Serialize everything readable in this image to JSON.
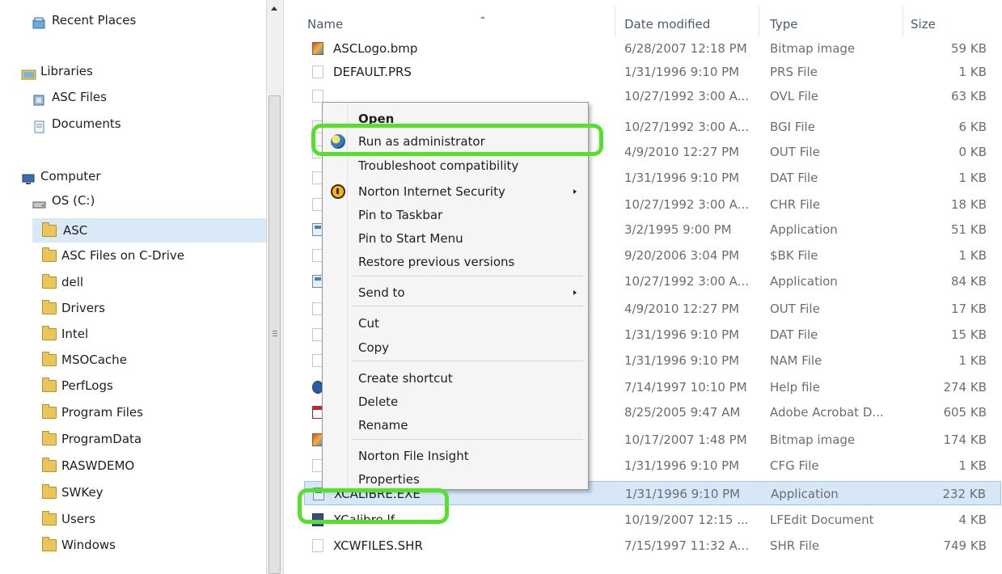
{
  "navigation": {
    "items": [
      {
        "label": "Recent Places",
        "icon": "recent-places-icon"
      },
      {
        "label": "Libraries",
        "icon": "libraries-icon"
      },
      {
        "label": "ASC Files",
        "icon": "library-icon"
      },
      {
        "label": "Documents",
        "icon": "documents-icon"
      },
      {
        "label": "Computer",
        "icon": "computer-icon"
      },
      {
        "label": "OS (C:)",
        "icon": "drive-icon"
      },
      {
        "label": "ASC",
        "icon": "folder-icon",
        "selected": true
      },
      {
        "label": "ASC Files on C-Drive",
        "icon": "folder-icon"
      },
      {
        "label": "dell",
        "icon": "folder-icon"
      },
      {
        "label": "Drivers",
        "icon": "folder-icon"
      },
      {
        "label": "Intel",
        "icon": "folder-icon"
      },
      {
        "label": "MSOCache",
        "icon": "folder-icon"
      },
      {
        "label": "PerfLogs",
        "icon": "folder-icon"
      },
      {
        "label": "Program Files",
        "icon": "folder-icon"
      },
      {
        "label": "ProgramData",
        "icon": "folder-icon"
      },
      {
        "label": "RASWDEMO",
        "icon": "folder-icon"
      },
      {
        "label": "SWKey",
        "icon": "folder-icon"
      },
      {
        "label": "Users",
        "icon": "folder-icon"
      },
      {
        "label": "Windows",
        "icon": "folder-icon"
      }
    ]
  },
  "file_list": {
    "columns": {
      "name": "Name",
      "date": "Date modified",
      "type": "Type",
      "size": "Size"
    },
    "rows": [
      {
        "name": "ASCLogo.bmp",
        "date": "6/28/2007 12:18 PM",
        "type": "Bitmap image",
        "size": "59 KB",
        "icon": "bmp"
      },
      {
        "name": "DEFAULT.PRS",
        "date": "1/31/1996 9:10 PM",
        "type": "PRS File",
        "size": "1 KB",
        "icon": "file"
      },
      {
        "name": "",
        "date": "10/27/1992 3:00 A...",
        "type": "OVL File",
        "size": "63 KB",
        "icon": "file"
      },
      {
        "name": "",
        "date": "10/27/1992 3:00 A...",
        "type": "BGI File",
        "size": "6 KB",
        "icon": "file"
      },
      {
        "name": "",
        "date": "4/9/2010 12:27 PM",
        "type": "OUT File",
        "size": "0 KB",
        "icon": "file"
      },
      {
        "name": "",
        "date": "1/31/1996 9:10 PM",
        "type": "DAT File",
        "size": "1 KB",
        "icon": "file"
      },
      {
        "name": "",
        "date": "10/27/1992 3:00 A...",
        "type": "CHR File",
        "size": "18 KB",
        "icon": "file"
      },
      {
        "name": "",
        "date": "3/2/1995 9:00 PM",
        "type": "Application",
        "size": "51 KB",
        "icon": "app"
      },
      {
        "name": "",
        "date": "9/20/2006 3:04 PM",
        "type": "$BK File",
        "size": "1 KB",
        "icon": "file"
      },
      {
        "name": "",
        "date": "10/27/1992 3:00 A...",
        "type": "Application",
        "size": "84 KB",
        "icon": "app"
      },
      {
        "name": "",
        "date": "4/9/2010 12:27 PM",
        "type": "OUT File",
        "size": "17 KB",
        "icon": "file"
      },
      {
        "name": "",
        "date": "1/31/1996 9:10 PM",
        "type": "DAT File",
        "size": "15 KB",
        "icon": "file"
      },
      {
        "name": "",
        "date": "1/31/1996 9:10 PM",
        "type": "NAM File",
        "size": "1 KB",
        "icon": "file"
      },
      {
        "name": "",
        "date": "7/14/1997 10:10 PM",
        "type": "Help file",
        "size": "274 KB",
        "icon": "help"
      },
      {
        "name": "",
        "date": "8/25/2005 9:47 AM",
        "type": "Adobe Acrobat D...",
        "size": "605 KB",
        "icon": "pdf"
      },
      {
        "name": "",
        "date": "10/17/2007 1:48 PM",
        "type": "Bitmap image",
        "size": "174 KB",
        "icon": "bmp"
      },
      {
        "name": "",
        "date": "1/31/1996 9:10 PM",
        "type": "CFG File",
        "size": "1 KB",
        "icon": "file"
      },
      {
        "name": "XCALIBRE.EXE",
        "date": "1/31/1996 9:10 PM",
        "type": "Application",
        "size": "232 KB",
        "icon": "app",
        "selected": true
      },
      {
        "name": "XCalibre.lf",
        "date": "10/19/2007 12:15 ...",
        "type": "LFEdit Document",
        "size": "4 KB",
        "icon": "lf"
      },
      {
        "name": "XCWFILES.SHR",
        "date": "7/15/1997 11:32 A...",
        "type": "SHR File",
        "size": "749 KB",
        "icon": "file"
      }
    ]
  },
  "context_menu": {
    "items": [
      {
        "label": "Open",
        "bold": true
      },
      {
        "label": "Run as administrator",
        "icon": "uac-shield-icon"
      },
      {
        "label": "Troubleshoot compatibility"
      },
      {
        "label": "Norton Internet Security",
        "icon": "norton-icon",
        "submenu": true
      },
      {
        "label": "Pin to Taskbar"
      },
      {
        "label": "Pin to Start Menu"
      },
      {
        "label": "Restore previous versions"
      },
      {
        "label": "Send to",
        "submenu": true
      },
      {
        "label": "Cut"
      },
      {
        "label": "Copy"
      },
      {
        "label": "Create shortcut"
      },
      {
        "label": "Delete"
      },
      {
        "label": "Rename"
      },
      {
        "label": "Norton File Insight"
      },
      {
        "label": "Properties"
      }
    ]
  },
  "colors": {
    "highlight_outline": "#55e02a",
    "selection_fill": "#d6e7f8",
    "menu_background": "#f5f5f5"
  }
}
